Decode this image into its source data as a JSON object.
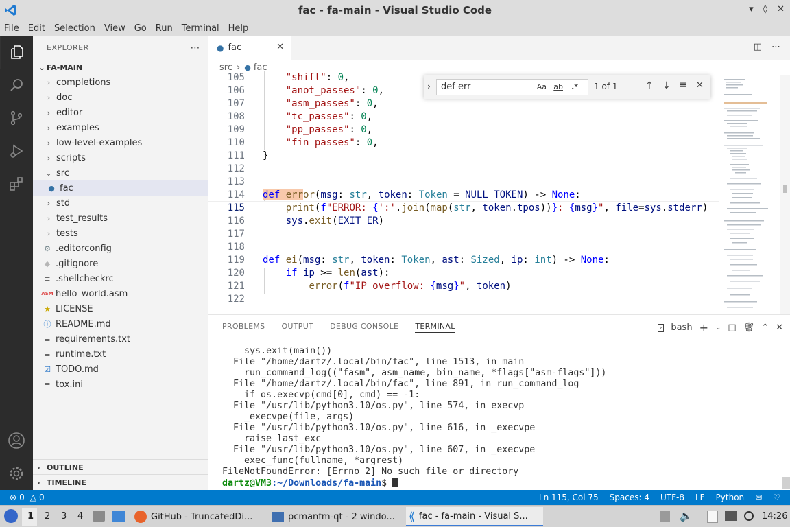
{
  "window": {
    "title": "fac - fa-main - Visual Studio Code"
  },
  "menu": [
    "File",
    "Edit",
    "Selection",
    "View",
    "Go",
    "Run",
    "Terminal",
    "Help"
  ],
  "sidebar": {
    "header": "EXPLORER",
    "root": "FA-MAIN",
    "items": [
      {
        "label": "completions",
        "type": "folder",
        "open": false
      },
      {
        "label": "doc",
        "type": "folder",
        "open": false
      },
      {
        "label": "editor",
        "type": "folder",
        "open": false
      },
      {
        "label": "examples",
        "type": "folder",
        "open": false
      },
      {
        "label": "low-level-examples",
        "type": "folder",
        "open": false
      },
      {
        "label": "scripts",
        "type": "folder",
        "open": false
      },
      {
        "label": "src",
        "type": "folder",
        "open": true
      },
      {
        "label": "fac",
        "type": "python",
        "child": true,
        "selected": true
      },
      {
        "label": "std",
        "type": "folder",
        "open": false
      },
      {
        "label": "test_results",
        "type": "folder",
        "open": false
      },
      {
        "label": "tests",
        "type": "folder",
        "open": false
      },
      {
        "label": ".editorconfig",
        "type": "gear"
      },
      {
        "label": ".gitignore",
        "type": "git"
      },
      {
        "label": ".shellcheckrc",
        "type": "lines"
      },
      {
        "label": "hello_world.asm",
        "type": "asm"
      },
      {
        "label": "LICENSE",
        "type": "license"
      },
      {
        "label": "README.md",
        "type": "info"
      },
      {
        "label": "requirements.txt",
        "type": "lines"
      },
      {
        "label": "runtime.txt",
        "type": "lines"
      },
      {
        "label": "TODO.md",
        "type": "todo"
      },
      {
        "label": "tox.ini",
        "type": "lines"
      }
    ],
    "outline": "OUTLINE",
    "timeline": "TIMELINE"
  },
  "editor": {
    "tab": "fac",
    "breadcrumb": [
      "src",
      "fac"
    ],
    "find": {
      "query": "def err",
      "result": "1 of 1",
      "case": "Aa",
      "word": "ab",
      "regex": ".*"
    },
    "lines": [
      {
        "n": "105",
        "html": "    <span class='str'>\"shift\"</span>: <span class='num'>0</span>,"
      },
      {
        "n": "106",
        "html": "    <span class='str'>\"anot_passes\"</span>: <span class='num'>0</span>,"
      },
      {
        "n": "107",
        "html": "    <span class='str'>\"asm_passes\"</span>: <span class='num'>0</span>,"
      },
      {
        "n": "108",
        "html": "    <span class='str'>\"tc_passes\"</span>: <span class='num'>0</span>,"
      },
      {
        "n": "109",
        "html": "    <span class='str'>\"pp_passes\"</span>: <span class='num'>0</span>,"
      },
      {
        "n": "110",
        "html": "    <span class='str'>\"fin_passes\"</span>: <span class='num'>0</span>,"
      },
      {
        "n": "111",
        "html": "}"
      },
      {
        "n": "112",
        "html": ""
      },
      {
        "n": "113",
        "html": ""
      },
      {
        "n": "114",
        "html": "<span class='hl'><span class='kw'>def</span> <span class='fn'>err</span></span><span class='fn'>or</span>(<span class='var'>msg</span>: <span class='cls'>str</span>, <span class='var'>token</span>: <span class='cls'>Token</span> = <span class='var'>NULL_TOKEN</span>) -> <span class='kw'>None</span>:"
      },
      {
        "n": "115",
        "html": "    <span class='fn'>print</span>(<span class='kw'>f</span><span class='str'>\"ERROR: </span><span class='kw'>{</span><span class='str'>':'</span>.<span class='fn'>join</span>(<span class='fn'>map</span>(<span class='cls'>str</span>, <span class='var'>token</span>.<span class='var'>tpos</span>))<span class='kw'>}</span><span class='str'>: </span><span class='kw'>{</span><span class='var'>msg</span><span class='kw'>}</span><span class='str'>\"</span>, <span class='var'>file</span>=<span class='var'>sys</span>.<span class='var'>stderr</span>)",
        "cur": true
      },
      {
        "n": "116",
        "html": "    <span class='var'>sys</span>.<span class='fn'>exit</span>(<span class='var'>EXIT_ER</span>)"
      },
      {
        "n": "117",
        "html": ""
      },
      {
        "n": "118",
        "html": ""
      },
      {
        "n": "119",
        "html": "<span class='kw'>def</span> <span class='fn'>ei</span>(<span class='var'>msg</span>: <span class='cls'>str</span>, <span class='var'>token</span>: <span class='cls'>Token</span>, <span class='var'>ast</span>: <span class='cls'>Sized</span>, <span class='var'>ip</span>: <span class='cls'>int</span>) -> <span class='kw'>None</span>:"
      },
      {
        "n": "120",
        "html": "    <span class='kw'>if</span> <span class='var'>ip</span> >= <span class='fn'>len</span>(<span class='var'>ast</span>):"
      },
      {
        "n": "121",
        "html": "        <span class='fn'>error</span>(<span class='kw'>f</span><span class='str'>\"IP overflow: </span><span class='kw'>{</span><span class='var'>msg</span><span class='kw'>}</span><span class='str'>\"</span>, <span class='var'>token</span>)"
      },
      {
        "n": "122",
        "html": ""
      }
    ]
  },
  "panel": {
    "tabs": [
      "PROBLEMS",
      "OUTPUT",
      "DEBUG CONSOLE",
      "TERMINAL"
    ],
    "active": "TERMINAL",
    "shell": "bash",
    "terminal": [
      "    sys.exit(main())",
      "  File \"/home/dartz/.local/bin/fac\", line 1513, in main",
      "    run_command_log((\"fasm\", asm_name, bin_name, *flags[\"asm-flags\"]))",
      "  File \"/home/dartz/.local/bin/fac\", line 891, in run_command_log",
      "    if os.execvp(cmd[0], cmd) == -1:",
      "  File \"/usr/lib/python3.10/os.py\", line 574, in execvp",
      "    _execvpe(file, args)",
      "  File \"/usr/lib/python3.10/os.py\", line 616, in _execvpe",
      "    raise last_exc",
      "  File \"/usr/lib/python3.10/os.py\", line 607, in _execvpe",
      "    exec_func(fullname, *argrest)",
      "FileNotFoundError: [Errno 2] No such file or directory"
    ],
    "prompt_user": "dartz@VM3",
    "prompt_path": ":~/Downloads/fa-main",
    "prompt_end": "$ "
  },
  "status": {
    "errors": "0",
    "warnings": "0",
    "position": "Ln 115, Col 75",
    "spaces": "Spaces: 4",
    "encoding": "UTF-8",
    "eol": "LF",
    "language": "Python"
  },
  "taskbar": {
    "workspaces": [
      "1",
      "2",
      "3",
      "4"
    ],
    "tasks": [
      {
        "label": "GitHub - TruncatedDi..."
      },
      {
        "label": "pcmanfm-qt - 2 windo..."
      },
      {
        "label": "fac - fa-main - Visual S..."
      }
    ],
    "clock": "14:26"
  },
  "colors": {
    "accent": "#007acc",
    "activity": "#2c2c2c",
    "sidebar": "#f3f3f3"
  }
}
